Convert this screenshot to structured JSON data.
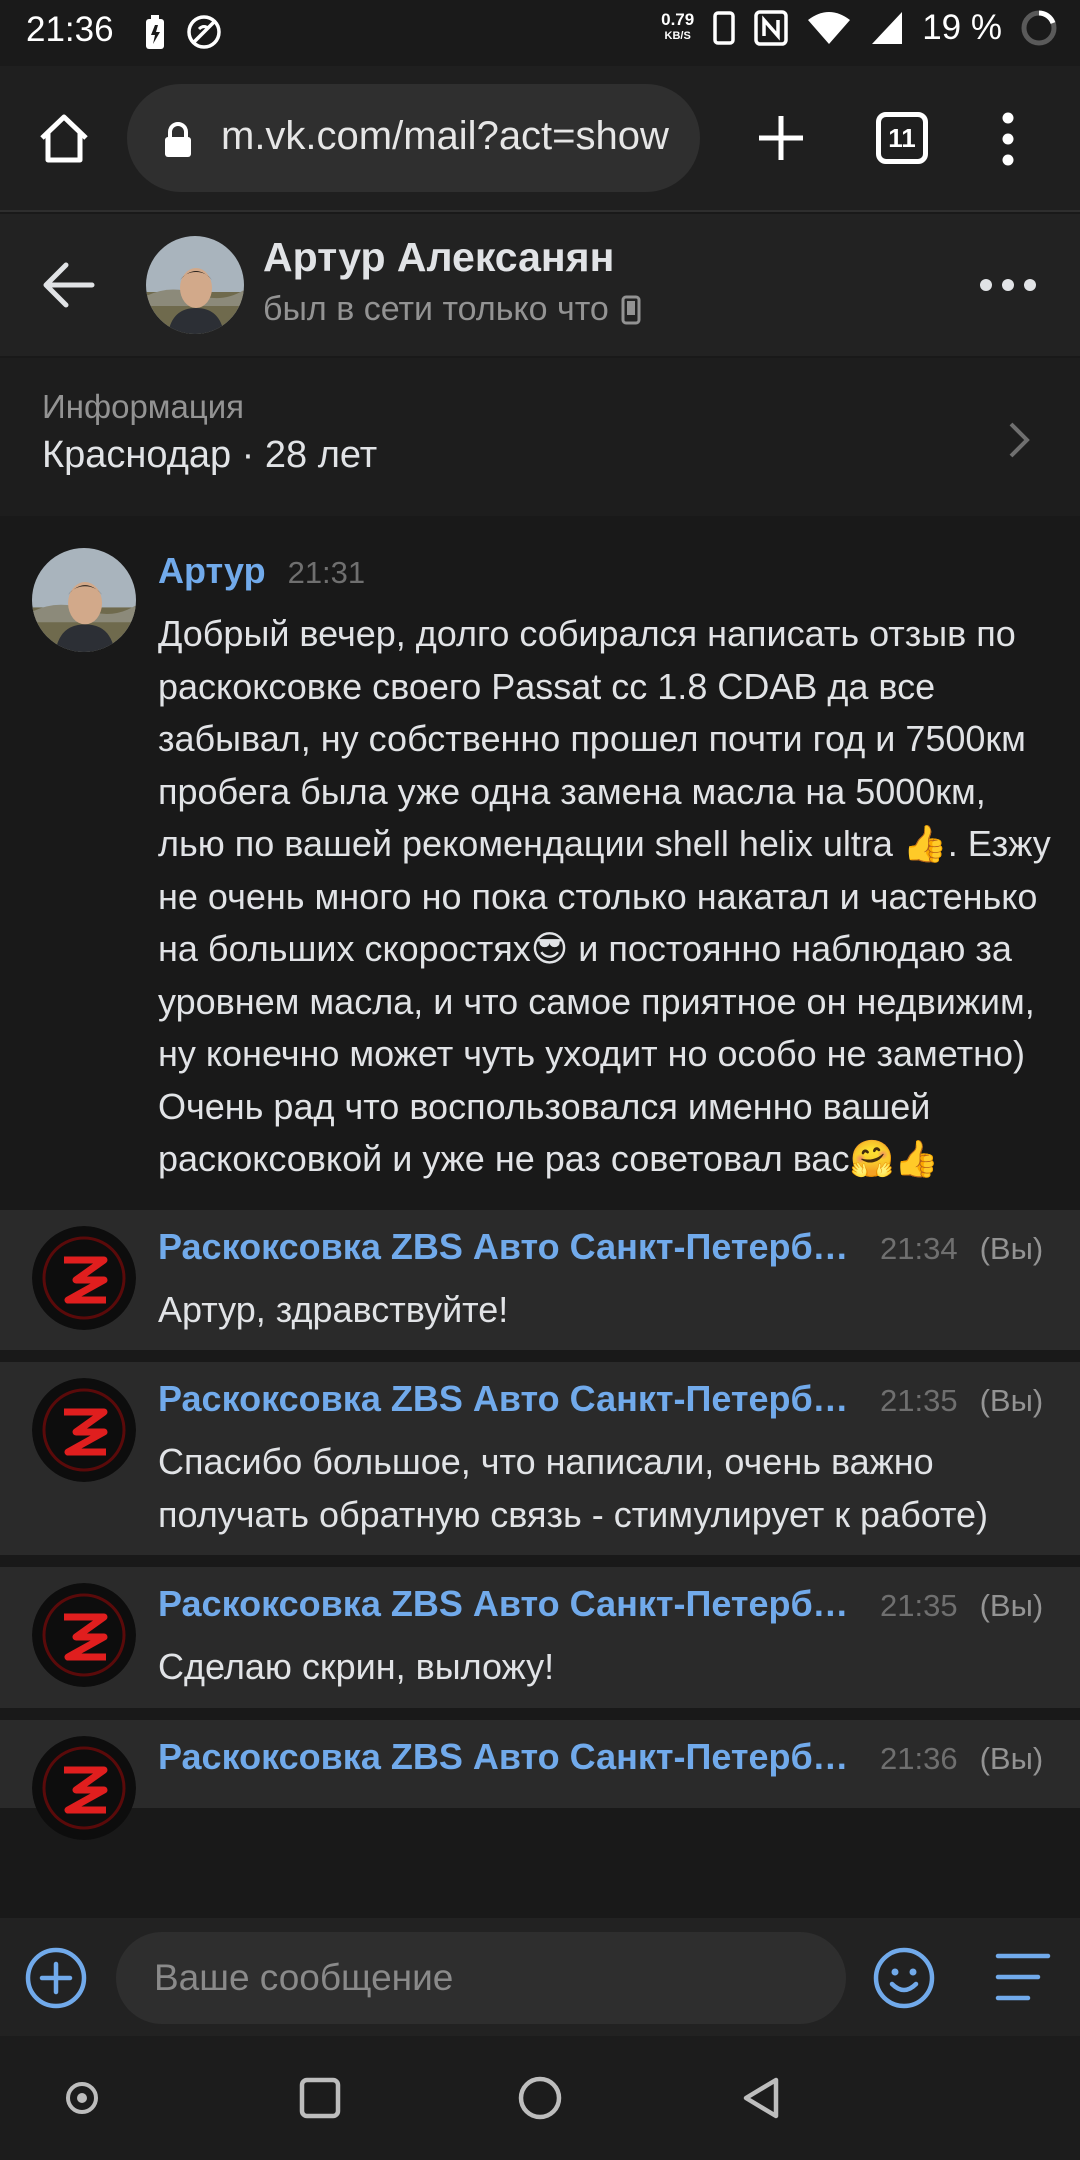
{
  "status_bar": {
    "time": "21:36",
    "speed_value": "0.79",
    "speed_unit": "KB/S",
    "battery": "19 %"
  },
  "browser": {
    "url": "m.vk.com/mail?act=show",
    "tab_count": "11"
  },
  "chat": {
    "name": "Артур Алексанян",
    "status": "был в сети только что"
  },
  "info": {
    "title": "Информация",
    "value": "Краснодар · 28 лет"
  },
  "messages": [
    {
      "author": "Артур",
      "time": "21:31",
      "you": "",
      "text": "Добрый вечер, долго собирался написать отзыв по раскоксовке своего Passat cc 1.8 CDAB да все забывал, ну собственно прошел почти год и 7500км пробега была уже одна замена масла на 5000км, лью по вашей рекомендации shell helix ultra 👍. Езжу не очень много но пока столько накатал и частенько на больших скоростях😎 и постоянно наблюдаю за уровнем масла, и что самое приятное он недвижим, ну конечно может чуть уходит но особо не заметно)\nОчень рад что воспользовался именно вашей раскоксовкой и уже не раз советовал вас🤗👍"
    },
    {
      "author": "Раскоксовка ZBS Авто Санкт-Петербург",
      "time": "21:34",
      "you": "(Вы)",
      "text": "Артур, здравствуйте!"
    },
    {
      "author": "Раскоксовка ZBS Авто Санкт-Петербург",
      "time": "21:35",
      "you": "(Вы)",
      "text": "Спасибо большое, что написали, очень важно получать обратную связь - стимулирует к работе)"
    },
    {
      "author": "Раскоксовка ZBS Авто Санкт-Петербург",
      "time": "21:35",
      "you": "(Вы)",
      "text": "Сделаю скрин, выложу!"
    },
    {
      "author": "Раскоксовка ZBS Авто Санкт-Петербург",
      "time": "21:36",
      "you": "(Вы)",
      "text": ""
    }
  ],
  "composer": {
    "placeholder": "Ваше сообщение"
  },
  "colors": {
    "accent": "#71aaeb",
    "background": "#191919",
    "brand_red": "#e01e1e"
  },
  "icons": {
    "home": "home-icon",
    "lock": "lock-icon",
    "new_tab": "plus-icon",
    "menu": "kebab-menu-icon",
    "back": "arrow-left-icon",
    "more": "more-dots-icon",
    "chevron": "chevron-right-icon",
    "attach": "plus-circle-icon",
    "emoji": "smile-icon",
    "keyboard": "menu-lines-icon"
  }
}
